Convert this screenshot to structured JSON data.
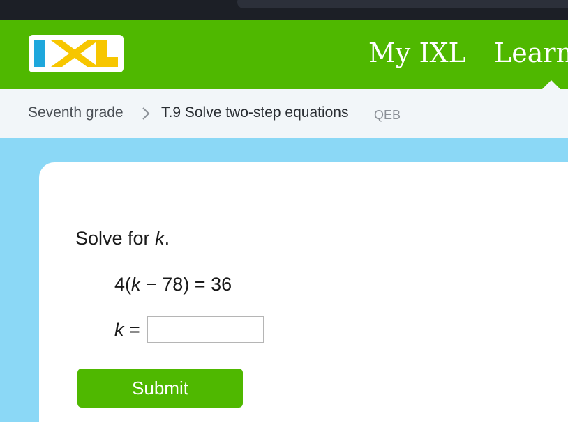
{
  "header": {
    "logo_text": "IXL",
    "nav": {
      "my_ixl": "My IXL",
      "learning": "Learn"
    }
  },
  "breadcrumb": {
    "grade": "Seventh grade",
    "skill": "T.9 Solve two-step equations",
    "code": "QEB"
  },
  "question": {
    "prompt_prefix": "Solve for ",
    "variable": "k",
    "prompt_suffix": ".",
    "equation_prefix": "4(",
    "equation_suffix": " − 78) = 36",
    "answer_suffix": " =",
    "answer_value": ""
  },
  "submit_label": "Submit",
  "colors": {
    "brand_green": "#4fb800",
    "content_blue": "#8bd8f6",
    "breadcrumb_bg": "#f2f6f9",
    "logo_blue": "#1ea7dc",
    "logo_yellow": "#f7c600"
  },
  "icons": {
    "breadcrumb_separator": "chevron-right-icon"
  }
}
